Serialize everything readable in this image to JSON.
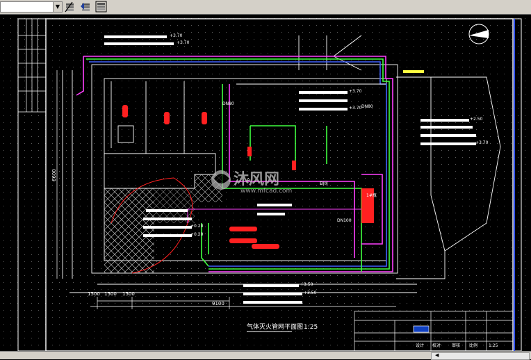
{
  "toolbar": {
    "combo_value": "",
    "buttons": [
      "layer-properties",
      "layer-previous",
      "layer-state"
    ]
  },
  "drawing": {
    "title_cn": "气体灭火管网平面图",
    "scale": "1:25",
    "watermark_brand": "沐风网",
    "watermark_url": "www.mfcad.com",
    "dims": {
      "left_v": "6600",
      "bottom_a": "1500",
      "bottom_b": "1500",
      "bottom_c": "1500",
      "bottom_total": "9100"
    },
    "labels": {
      "dn_a": "DN80",
      "dn_b": "DN80",
      "dn_c": "DN100",
      "room_a": "A",
      "room_b": "B间",
      "gas": "1#瓶",
      "elev_a": "+3.70",
      "elev_b": "+3.70",
      "elev_c": "+0.20",
      "elev_d": "+0.20",
      "elev_e": "+2.50",
      "elev_f": "+3.70",
      "elev_g": "+3.50",
      "elev_h": "+3.50",
      "elev_i": "+3.70",
      "elev_j": "+3.70"
    },
    "titleblock": {
      "c1": "设计",
      "c2": "校对",
      "c3": "审核",
      "c4": "比例",
      "c5": "1:25"
    }
  }
}
